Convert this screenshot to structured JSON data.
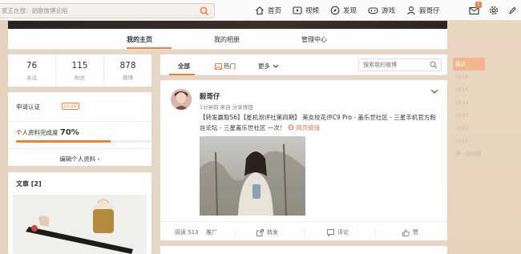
{
  "topbar": {
    "search_placeholder": "家正在搜：胡歌微博论陷",
    "nav": [
      {
        "label": "首页",
        "icon": "home-icon"
      },
      {
        "label": "视频",
        "icon": "video-icon"
      },
      {
        "label": "发现",
        "icon": "compass-icon"
      },
      {
        "label": "游戏",
        "icon": "gamepad-icon"
      },
      {
        "label": "毅哥仔",
        "icon": "user-icon"
      }
    ],
    "message_badge": "1"
  },
  "profile_tabs": [
    "我的主页",
    "我的相册",
    "管理中心"
  ],
  "stats": [
    {
      "num": "76",
      "label": "关注"
    },
    {
      "num": "115",
      "label": "粉丝"
    },
    {
      "num": "878",
      "label": "微博"
    }
  ],
  "info": {
    "verify_label": "申请认证",
    "level": "Lv.22",
    "completeness_label": "个人资料完成度",
    "completeness_value": "70%",
    "completeness_fraction": 0.7,
    "edit_label": "编辑个人资料 ›"
  },
  "articles": {
    "title": "文章 [2]"
  },
  "feed": {
    "tabs": [
      "全部",
      "热门",
      "更多"
    ],
    "search_placeholder": "搜索我的微博"
  },
  "post": {
    "name": "毅哥仔",
    "meta": "1分钟前 来自 分享按钮",
    "text": "【转发赢取S6】【星机测评社第四期】 美女校花评C9 Pro - 盖乐世社区 - 三星手机官方粉丝论坛 - 三星盖乐世社区 一次！",
    "link_label": "网页链接",
    "actions": {
      "read": "阅读 513",
      "promote": "推广",
      "forward": "转发",
      "comment": "评论",
      "like": "赞"
    }
  },
  "timeline": [
    "最近",
    "2016",
    "2015",
    "2014",
    "2013",
    "2012",
    "2011",
    "第一条微博"
  ]
}
